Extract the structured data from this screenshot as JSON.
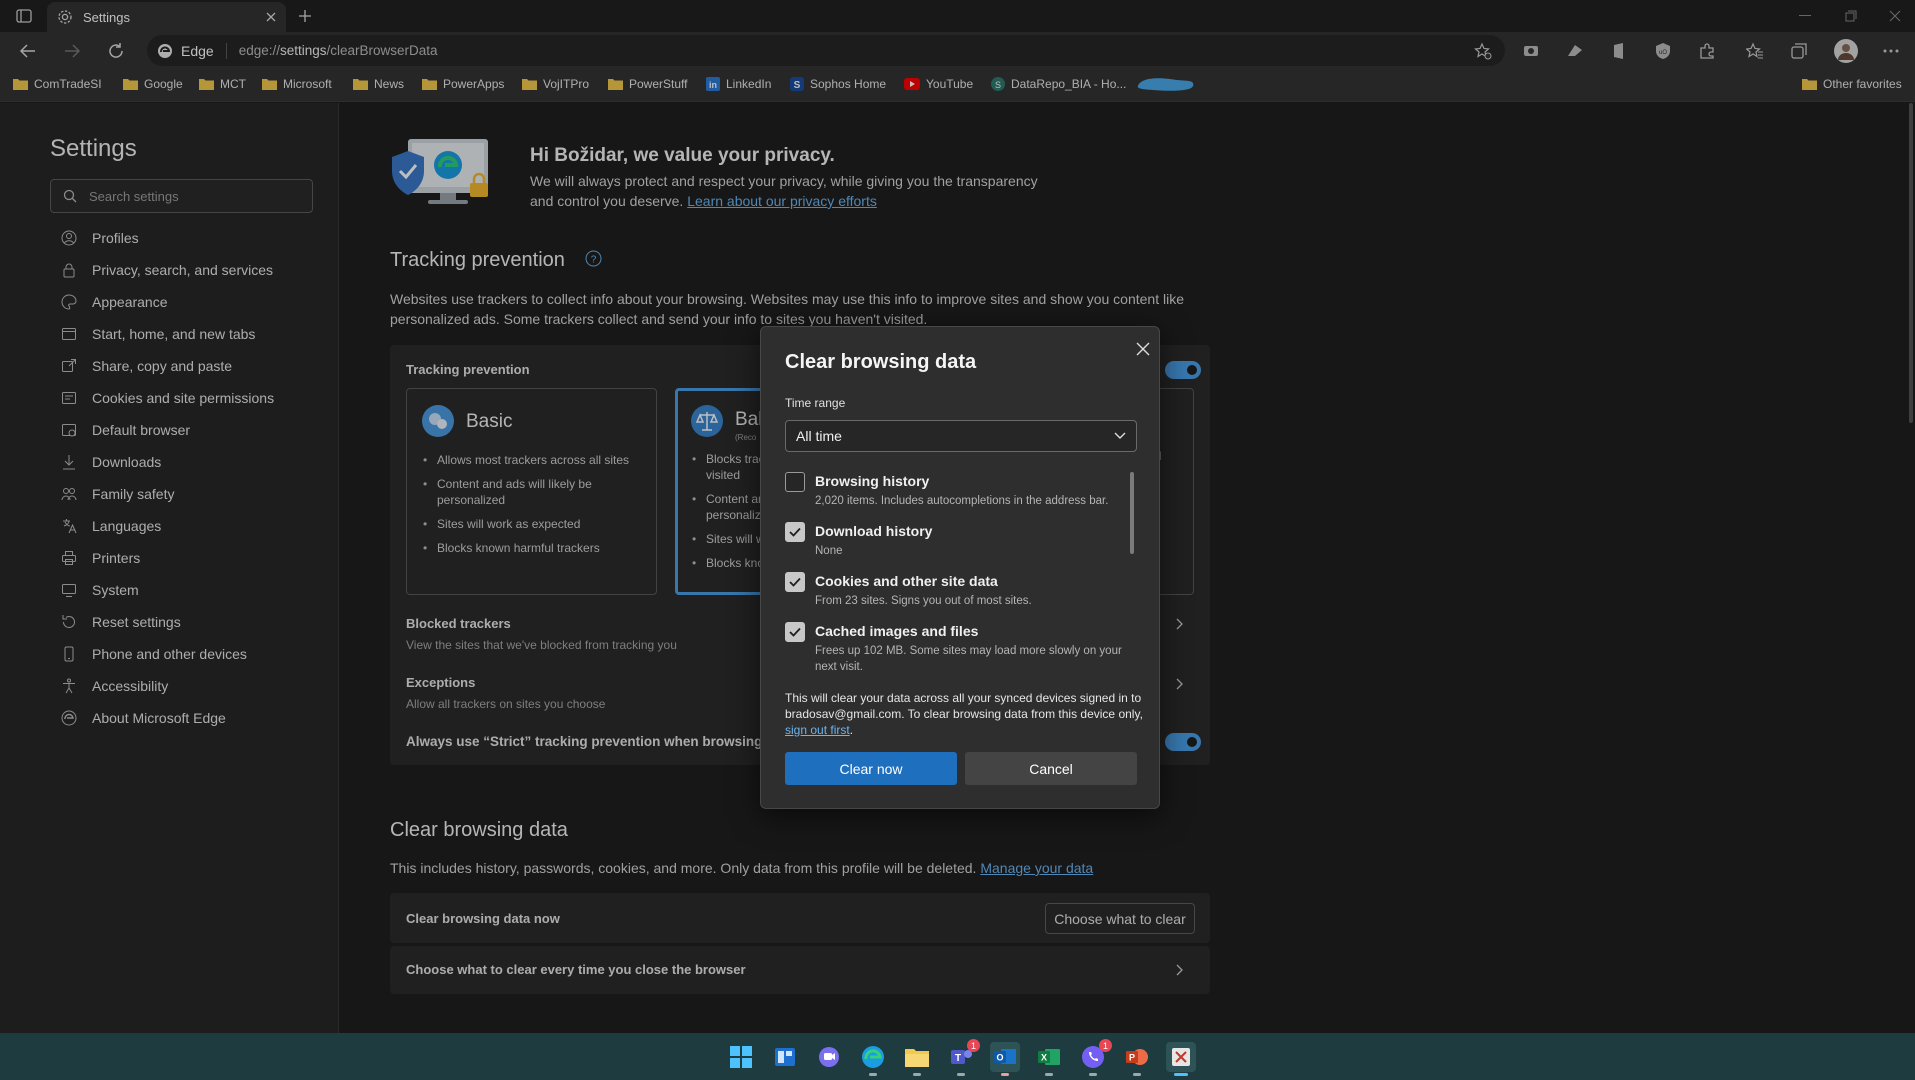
{
  "tab": {
    "title": "Settings"
  },
  "address": {
    "brand": "Edge",
    "url_prefix": "edge://",
    "url_path": "settings",
    "url_rest": "/clearBrowserData"
  },
  "favorites": [
    {
      "label": "ComTradeSI",
      "icon": "folder-icon"
    },
    {
      "label": "Google",
      "icon": "folder-icon"
    },
    {
      "label": "MCT",
      "icon": "folder-icon"
    },
    {
      "label": "Microsoft",
      "icon": "folder-icon"
    },
    {
      "label": "News",
      "icon": "folder-icon"
    },
    {
      "label": "PowerApps",
      "icon": "folder-icon"
    },
    {
      "label": "VojITPro",
      "icon": "folder-icon"
    },
    {
      "label": "PowerStuff",
      "icon": "folder-icon"
    },
    {
      "label": "LinkedIn",
      "icon": "linkedin-icon"
    },
    {
      "label": "Sophos Home",
      "icon": "sophos-icon"
    },
    {
      "label": "YouTube",
      "icon": "youtube-icon"
    },
    {
      "label": "DataRepo_BIA - Ho...",
      "icon": "site-icon"
    }
  ],
  "other_favorites": "Other favorites",
  "sidebar": {
    "title": "Settings",
    "search_placeholder": "Search settings",
    "items": [
      {
        "label": "Profiles"
      },
      {
        "label": "Privacy, search, and services"
      },
      {
        "label": "Appearance"
      },
      {
        "label": "Start, home, and new tabs"
      },
      {
        "label": "Share, copy and paste"
      },
      {
        "label": "Cookies and site permissions"
      },
      {
        "label": "Default browser"
      },
      {
        "label": "Downloads"
      },
      {
        "label": "Family safety"
      },
      {
        "label": "Languages"
      },
      {
        "label": "Printers"
      },
      {
        "label": "System"
      },
      {
        "label": "Reset settings"
      },
      {
        "label": "Phone and other devices"
      },
      {
        "label": "Accessibility"
      },
      {
        "label": "About Microsoft Edge"
      }
    ]
  },
  "privacy": {
    "heading": "Hi Božidar, we value your privacy.",
    "line1": "We will always protect and respect your privacy, while giving you the transparency",
    "line2": "and control you deserve.",
    "link": "Learn about our privacy efforts"
  },
  "tracking": {
    "heading": "Tracking prevention",
    "desc1": "Websites use trackers to collect info about your browsing. Websites may use this info to improve sites and show you content like",
    "desc2": "personalized ads. Some trackers collect and send your info to sites you haven't visited.",
    "card_title": "Tracking prevention",
    "basic": {
      "title": "Basic",
      "bullets": [
        "Allows most trackers across all sites",
        "Content and ads will likely be personalized",
        "Sites will work as expected",
        "Blocks known harmful trackers"
      ]
    },
    "balanced": {
      "title": "Bal",
      "recommended": "(Reco",
      "bullets": [
        "Blocks trac visited",
        "Content ar personaliz",
        "Sites will w",
        "Blocks kno"
      ]
    },
    "strict_fragment": "ll",
    "blocked_title": "Blocked trackers",
    "blocked_desc": "View the sites that we've blocked from tracking you",
    "exceptions_title": "Exceptions",
    "exceptions_desc": "Allow all trackers on sites you choose",
    "always_strict": "Always use “Strict” tracking prevention when browsing I"
  },
  "clear_section": {
    "heading": "Clear browsing data",
    "desc": "This includes history, passwords, cookies, and more. Only data from this profile will be deleted.",
    "link": "Manage your data",
    "now_label": "Clear browsing data now",
    "choose_button": "Choose what to clear",
    "every_time": "Choose what to clear every time you close the browser"
  },
  "dialog": {
    "title": "Clear browsing data",
    "time_range_label": "Time range",
    "time_range_value": "All time",
    "options": [
      {
        "title": "Browsing history",
        "desc": "2,020 items. Includes autocompletions in the address bar.",
        "checked": false
      },
      {
        "title": "Download history",
        "desc": "None",
        "checked": true
      },
      {
        "title": "Cookies and other site data",
        "desc": "From 23 sites. Signs you out of most sites.",
        "checked": true
      },
      {
        "title": "Cached images and files",
        "desc": "Frees up 102 MB. Some sites may load more slowly on your next visit.",
        "checked": true
      }
    ],
    "note": "This will clear your data across all your synced devices signed in to bradosav@gmail.com. To clear browsing data from this device only,",
    "note_link": "sign out first",
    "note_end": ".",
    "clear_button": "Clear now",
    "cancel_button": "Cancel"
  },
  "taskbar": {
    "teams_badge": "1",
    "viber_badge": "1"
  },
  "colors": {
    "accent": "#1f6fbf",
    "link": "#6cb5f0",
    "toggle": "#4a9fe8"
  }
}
